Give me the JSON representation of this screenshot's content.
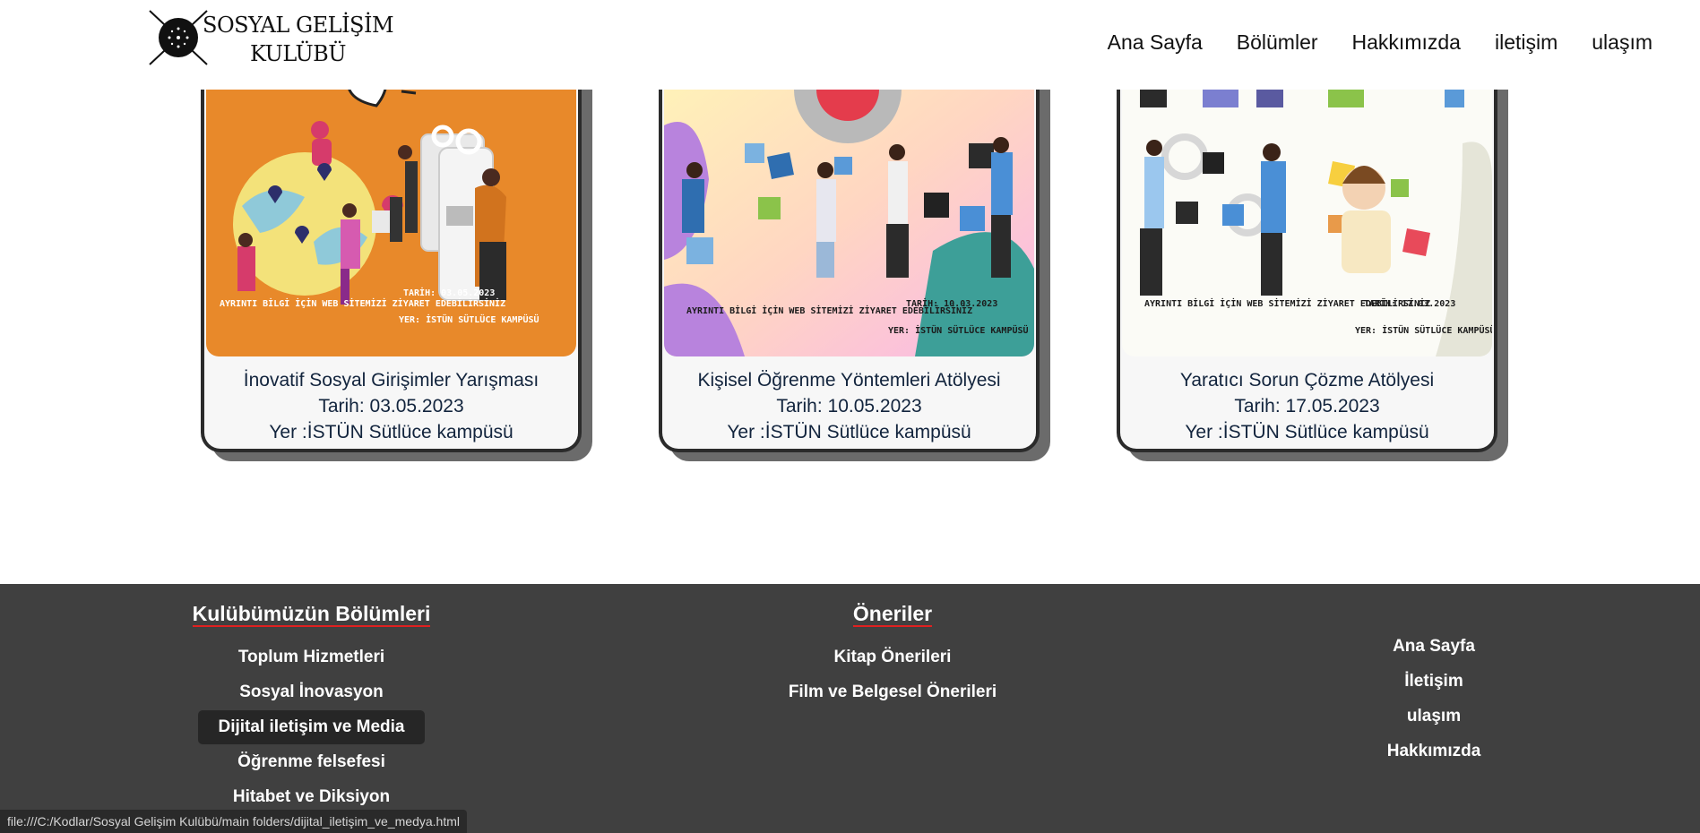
{
  "header": {
    "logo_line1": "SOSYAL GELİŞİM",
    "logo_line2": "KULÜBÜ",
    "nav": [
      "Ana Sayfa",
      "Bölümler",
      "Hakkımızda",
      "iletişim",
      "ulaşım"
    ]
  },
  "cards": [
    {
      "title": "İnovatif Sosyal Girişimler Yarışması",
      "date": "Tarih: 03.05.2023",
      "place": "Yer :İSTÜN Sütlüce kampüsü",
      "poster_info": "AYRINTI BİLGİ İÇİN WEB SİTEMİZİ ZİYARET EDEBİLİRSİNİZ",
      "poster_date": "TARİH: 03.05.2023",
      "poster_place": "YER: İSTÜN SÜTLÜCE KAMPÜSÜ"
    },
    {
      "title": "Kişisel Öğrenme Yöntemleri Atölyesi",
      "date": "Tarih: 10.05.2023",
      "place": "Yer :İSTÜN Sütlüce kampüsü",
      "poster_info": "AYRINTI BİLGİ İÇİN WEB SİTEMİZİ ZİYARET EDEBİLİRSİNİZ",
      "poster_date": "TARİH: 10.03.2023",
      "poster_place": "YER: İSTÜN SÜTLÜCE KAMPÜSÜ"
    },
    {
      "title": "Yaratıcı Sorun Çözme Atölyesi",
      "date": "Tarih: 17.05.2023",
      "place": "Yer :İSTÜN Sütlüce kampüsü",
      "poster_info": "AYRINTI BİLGİ İÇİN WEB SİTEMİZİ ZİYARET EDEBİLİRSİNİZ",
      "poster_date": "TARİH: 17.03.2023",
      "poster_place": "YER: İSTÜN SÜTLÜCE KAMPÜSÜ"
    }
  ],
  "footer": {
    "sections_title": "Kulübümüzün Bölümleri",
    "sections": [
      "Toplum Hizmetleri",
      "Sosyal İnovasyon",
      "Dijital iletişim ve Media",
      "Öğrenme felsefesi",
      "Hitabet ve Diksiyon"
    ],
    "suggestions_title": "Öneriler",
    "suggestions": [
      "Kitap Önerileri",
      "Film ve Belgesel Önerileri"
    ],
    "links": [
      "Ana Sayfa",
      "İletişim",
      "ulaşım",
      "Hakkımızda"
    ]
  },
  "status_url": "file:///C:/Kodlar/Sosyal Gelişim Kulübü/main folders/dijital_iletişim_ve_medya.html",
  "colors": {
    "footer_bg": "#404040",
    "heading_underline": "#e02020",
    "card_text": "#12243d",
    "poster1_bg": "#e8892a"
  }
}
